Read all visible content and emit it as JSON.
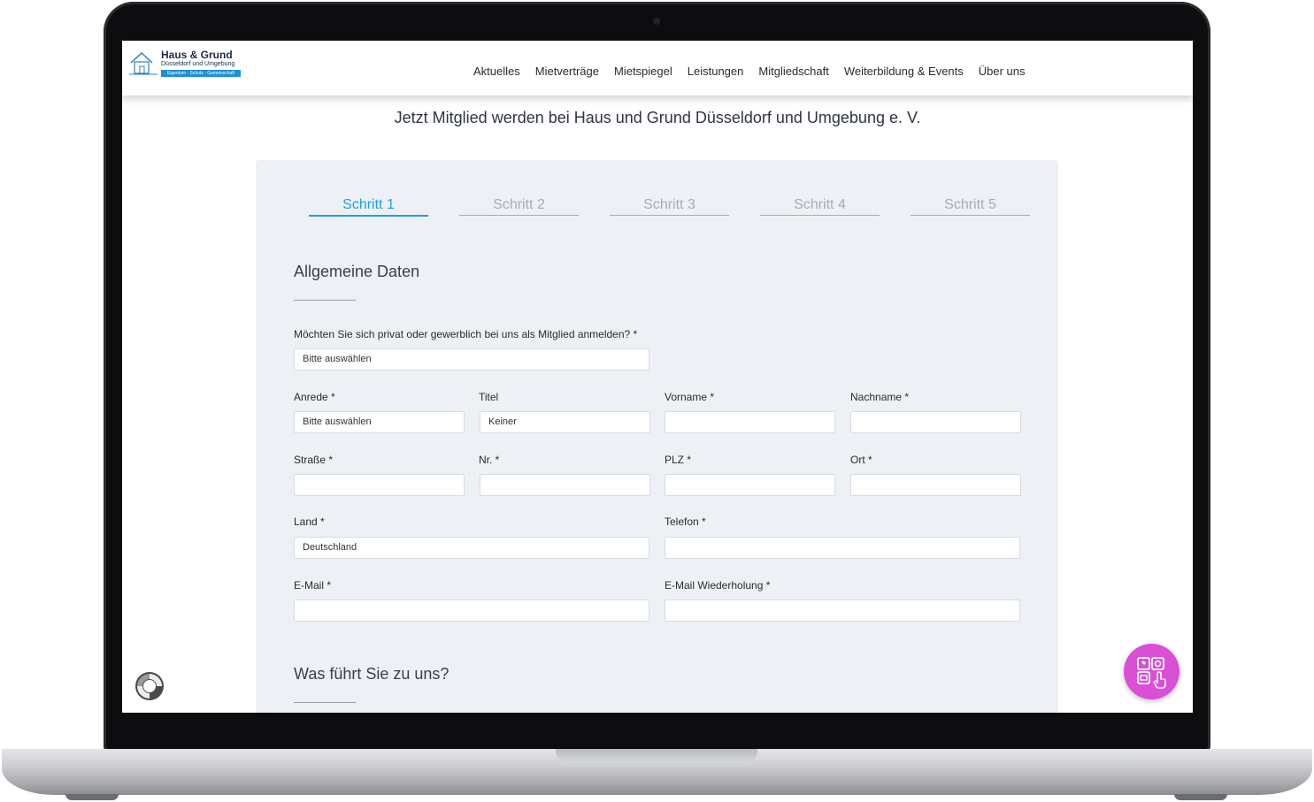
{
  "header": {
    "logo": {
      "title": "Haus & Grund",
      "subtitle": "Düsseldorf und Umgebung",
      "tagline": "Eigentum · Schutz · Gemeinschaft"
    },
    "nav": [
      "Aktuelles",
      "Mietverträge",
      "Mietspiegel",
      "Leistungen",
      "Mitgliedschaft",
      "Weiterbildung & Events",
      "Über uns"
    ]
  },
  "page": {
    "heading": "Jetzt Mitglied werden bei Haus und Grund Düsseldorf und Umgebung e. V."
  },
  "steps": [
    "Schritt 1",
    "Schritt 2",
    "Schritt 3",
    "Schritt 4",
    "Schritt 5"
  ],
  "active_step": 1,
  "section1": {
    "title": "Allgemeine Daten",
    "membership_type": {
      "label": "Möchten Sie sich privat oder gewerblich bei uns als Mitglied anmelden? *",
      "value": "Bitte auswählen"
    },
    "anrede": {
      "label": "Anrede *",
      "value": "Bitte auswählen"
    },
    "titel": {
      "label": "Titel",
      "value": "Keiner"
    },
    "vorname": {
      "label": "Vorname *",
      "value": ""
    },
    "nachname": {
      "label": "Nachname *",
      "value": ""
    },
    "strasse": {
      "label": "Straße *",
      "value": ""
    },
    "nr": {
      "label": "Nr. *",
      "value": ""
    },
    "plz": {
      "label": "PLZ *",
      "value": ""
    },
    "ort": {
      "label": "Ort *",
      "value": ""
    },
    "land": {
      "label": "Land *",
      "value": "Deutschland"
    },
    "telefon": {
      "label": "Telefon *",
      "value": ""
    },
    "email": {
      "label": "E-Mail *",
      "value": ""
    },
    "email_repeat": {
      "label": "E-Mail Wiederholung *",
      "value": ""
    }
  },
  "section2": {
    "title": "Was führt Sie zu uns?"
  },
  "colors": {
    "accent": "#1ea0e0",
    "panel": "#edf0f4",
    "fab": "#d94fd6"
  },
  "icons": {
    "recaptcha": "recaptcha-icon",
    "fab": "contact-apps-icon"
  }
}
